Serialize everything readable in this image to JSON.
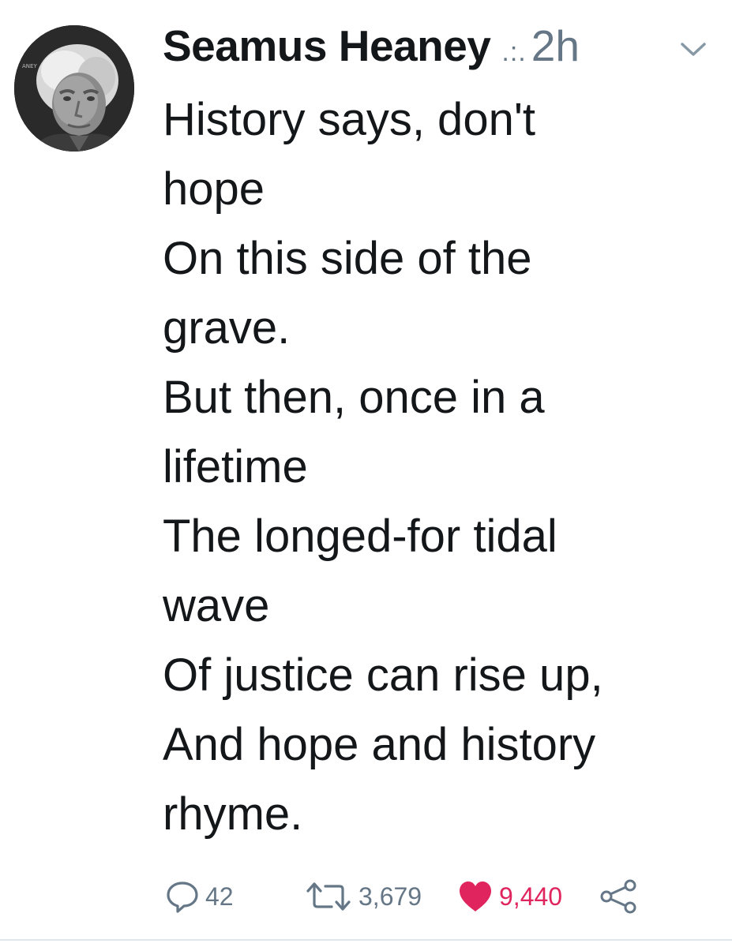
{
  "tweet": {
    "author_name": "Seamus Heaney",
    "handle_dots": ".:.",
    "time": "2h",
    "lines": [
      "History says, don't",
      "hope",
      "On this side of the",
      "grave.",
      "But then, once in a",
      "lifetime",
      "The longed-for tidal",
      "wave",
      "Of justice can rise up,",
      "And hope and history",
      "rhyme."
    ],
    "avatar_label": "ANEY"
  },
  "actions": {
    "reply_icon": "reply-bubble-icon",
    "reply_count": "42",
    "retweet_icon": "retweet-icon",
    "retweet_count": "3,679",
    "like_icon": "heart-icon",
    "like_count": "9,440",
    "like_color": "#e0245e",
    "share_icon": "share-icon"
  },
  "colors": {
    "text": "#14171a",
    "muted": "#657786",
    "liked": "#e0245e"
  }
}
